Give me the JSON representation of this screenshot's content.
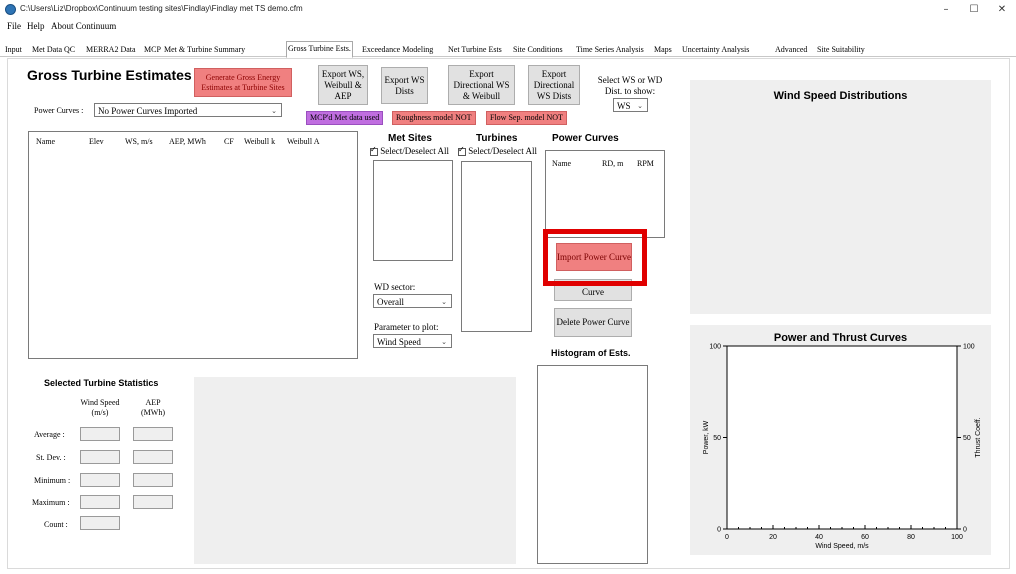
{
  "window": {
    "title": "C:\\Users\\Liz\\Dropbox\\Continuum testing sites\\Findlay\\Findlay met TS demo.cfm",
    "minimize": "–",
    "maximize": "☐",
    "close": "✕"
  },
  "menu": [
    "File",
    "Help",
    "About Continuum"
  ],
  "tabs": [
    "Input",
    "Met Data QC",
    "MERRA2 Data",
    "MCP",
    "Met & Turbine Summary",
    "Gross Turbine Ests.",
    "Exceedance Modeling",
    "Net Turbine Ests",
    "Site Conditions",
    "Time Series Analysis",
    "Maps",
    "Uncertainty Analysis",
    "Advanced",
    "Site Suitability"
  ],
  "active_tab": "Gross Turbine Ests.",
  "gross": {
    "title": "Gross Turbine Estimates",
    "generate_button": "Generate Gross Energy Estimates at Turbine Sites",
    "power_curves_label": "Power Curves :",
    "power_curves_value": "No Power Curves Imported",
    "table_columns": [
      "Name",
      "Elev",
      "WS, m/s",
      "AEP, MWh",
      "CF",
      "Weibull k",
      "Weibull A"
    ]
  },
  "export": {
    "ws_weibull_aep": "Export WS, Weibull & AEP",
    "ws_dists": "Export WS Dists",
    "dir_ws_weibull": "Export Directional WS & Weibull",
    "dir_ws_dists": "Export Directional WS Dists"
  },
  "select_dist": {
    "label": "Select WS or WD Dist. to show:",
    "value": "WS"
  },
  "status_tags": {
    "mcp": "MCP'd Met data used",
    "roughness": "Roughness model NOT",
    "flowsep": "Flow Sep. model NOT"
  },
  "met_sites": {
    "title": "Met Sites",
    "select_all": "Select/Deselect All"
  },
  "turbines": {
    "title": "Turbines",
    "select_all": "Select/Deselect All"
  },
  "power_curves_panel": {
    "title": "Power Curves",
    "columns": [
      "Name",
      "RD, m",
      "RPM"
    ],
    "import_button": "Import Power Curve",
    "edit_button_partial": "Curve",
    "delete_button": "Delete Power Curve"
  },
  "wd_sector": {
    "label": "WD sector:",
    "value": "Overall"
  },
  "parameter": {
    "label": "Parameter to plot:",
    "value": "Wind Speed"
  },
  "histogram": {
    "title": "Histogram of Ests."
  },
  "wind_speed_dist": {
    "title": "Wind Speed Distributions"
  },
  "stats": {
    "title": "Selected Turbine Statistics",
    "col_ws": "Wind Speed (m/s)",
    "col_aep": "AEP (MWh)",
    "rows": [
      "Average :",
      "St. Dev. :",
      "Minimum :",
      "Maximum :",
      "Count :"
    ]
  },
  "chart_data": {
    "type": "line",
    "title": "Power and Thrust Curves",
    "xlabel": "Wind Speed, m/s",
    "ylabel": "Power, kW",
    "y2label": "Thrust Coeff.",
    "xlim": [
      0,
      100
    ],
    "ylim": [
      0,
      100
    ],
    "y2lim": [
      0,
      100
    ],
    "xticks": [
      0,
      20,
      40,
      60,
      80,
      100
    ],
    "yticks": [
      0,
      50,
      100
    ],
    "y2ticks": [
      0,
      50,
      100
    ],
    "series": []
  },
  "highlight_color": "#e00000",
  "accent_red": "#f08080",
  "accent_purple": "#c06ee0"
}
